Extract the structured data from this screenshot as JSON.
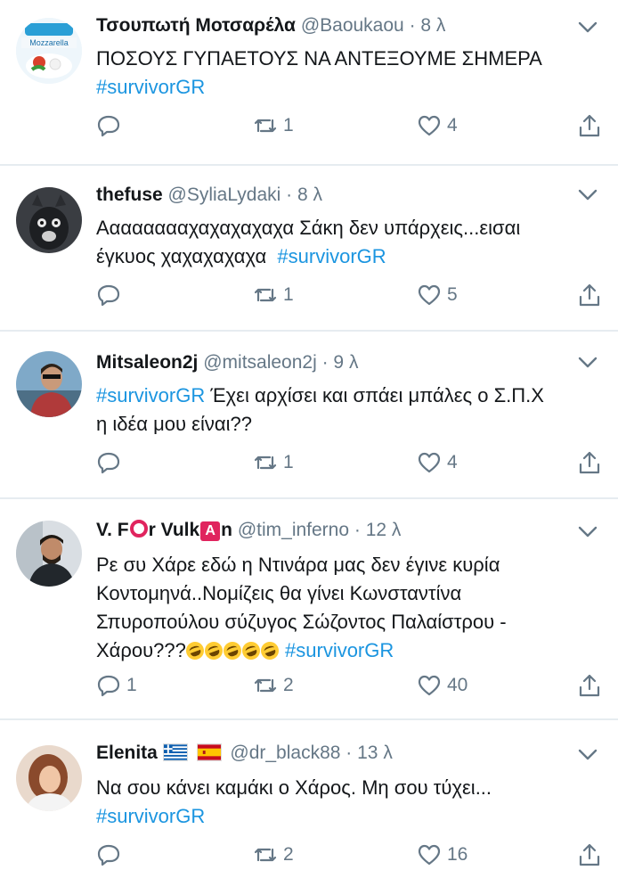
{
  "tweets": [
    {
      "name": "Τσουπωτή Μοτσαρέλα",
      "handle": "@Baoukaou",
      "time": "· 8 λ",
      "line1": "ΠΟΣΟΥΣ ΓΥΠΑΕΤΟΥΣ ΝΑ ΑΝΤΕΞΟΥΜΕ ΣΗΜΕΡΑ",
      "hashtag": "#survivorGR",
      "replies": "",
      "retweets": "1",
      "likes": "4",
      "avatar_text": "Mozzarella"
    },
    {
      "name": "thefuse",
      "handle": "@SyliaLydaki",
      "time": "· 8 λ",
      "line1": "Ααααααααχαχαχαχαχα Σάκη δεν υπάρχεις...εισαι",
      "line2": "έγκυος χαχαχαχαχα",
      "hashtag": "#survivorGR",
      "replies": "",
      "retweets": "1",
      "likes": "5"
    },
    {
      "name": "Mitsaleon2j",
      "handle": "@mitsaleon2j",
      "time": "· 9 λ",
      "hashtag": "#survivorGR",
      "line1_rest": " Έχει αρχίσει και σπάει μπάλες ο Σ.Π.Χ",
      "line2": "η ιδέα μου είναι??",
      "replies": "",
      "retweets": "1",
      "likes": "4"
    },
    {
      "name_part1": "V. F",
      "name_part2": "r Vulk",
      "name_box": "A",
      "name_part3": "n",
      "handle": "@tim_inferno",
      "time": "· 12 λ",
      "line1": "Ρε συ Χάρε εδώ η Ντινάρα μας δεν έγινε κυρία",
      "line2": "Κοντομηνά..Νομίζεις θα γίνει Κωνσταντίνα",
      "line3": "Σπυροπούλου σύζυγος Σώζοντος Παλαίστρου -",
      "line4": "Χάρου???",
      "hashtag": "#survivorGR",
      "replies": "1",
      "retweets": "2",
      "likes": "40"
    },
    {
      "name": "Elenita",
      "handle": "@dr_black88",
      "time": "· 13 λ",
      "line1": "Να σου κάνει καμάκι ο Χάρος. Μη σου τύχει...",
      "hashtag": "#survivorGR",
      "replies": "",
      "retweets": "2",
      "likes": "16"
    }
  ],
  "colors": {
    "hashtag": "#1b95e0",
    "handle": "#657786",
    "divider": "#e6ecf0"
  },
  "icons": [
    "reply-icon",
    "retweet-icon",
    "like-icon",
    "share-icon",
    "chevron-down-icon"
  ]
}
